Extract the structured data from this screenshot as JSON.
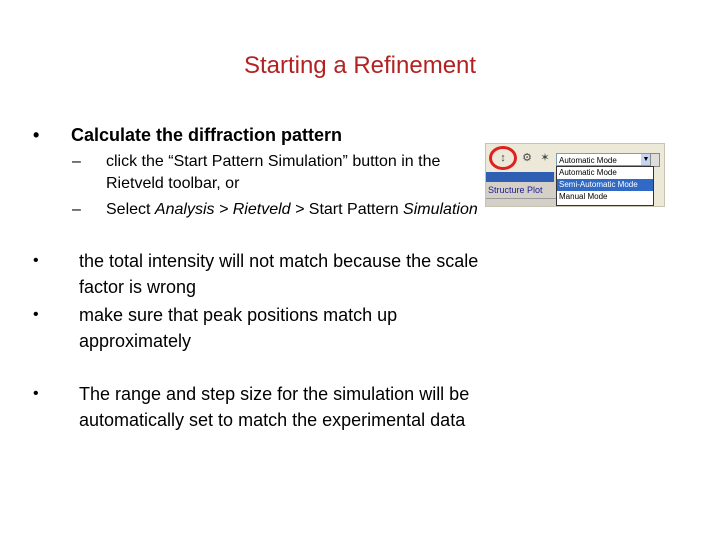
{
  "slide": {
    "title": "Starting a Refinement",
    "bullets": [
      {
        "text": "Calculate the diffraction pattern"
      },
      {
        "text": "the total intensity will not match because the scale factor is wrong"
      },
      {
        "text": "make sure that peak positions match up approximately"
      },
      {
        "text": "The range and step size for the simulation will be automatically set to match the experimental data"
      }
    ],
    "subbullets": [
      {
        "text": "click the “Start Pattern Simulation” button in the Rietveld toolbar, or"
      },
      {
        "text_prefix": "Select ",
        "text_italic": "Analysis > Rietveld > ",
        "text_mid": "Start Pattern ",
        "text_italic2": "Simulation"
      }
    ],
    "glyphs": {
      "bullet": "•",
      "dash": "–"
    }
  },
  "toolbar_shot": {
    "combo_value": "Automatic Mode",
    "options": [
      "Automatic Mode",
      "Semi-Automatic Mode",
      "Manual Mode"
    ],
    "selected_index": 1,
    "side_label_1": "Structure Plot",
    "accent": "#e02020"
  }
}
